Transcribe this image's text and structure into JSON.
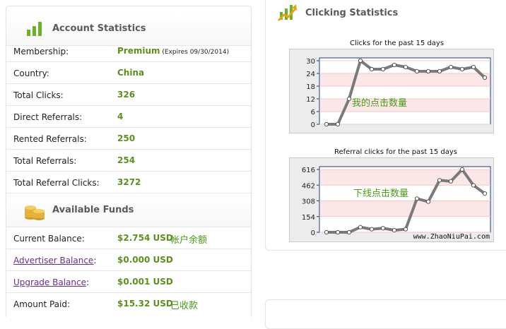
{
  "account": {
    "title": "Account Statistics",
    "rows": [
      {
        "label": "Membership:",
        "value": "Premium",
        "note": " (Expires 09/30/2014)"
      },
      {
        "label": "Country:",
        "value": "China"
      },
      {
        "label": "Total Clicks:",
        "value": "326"
      },
      {
        "label": "Direct Referrals:",
        "value": "4"
      },
      {
        "label": "Rented Referrals:",
        "value": "250"
      },
      {
        "label": "Total Referrals:",
        "value": "254"
      },
      {
        "label": "Total Referral Clicks:",
        "value": "3272"
      }
    ]
  },
  "funds": {
    "title": "Available Funds",
    "rows": [
      {
        "label": "Current Balance:",
        "value": "$2.754 USD",
        "annotation": "帐户余额"
      },
      {
        "label": "Advertiser Balance",
        "suffix": ":",
        "value": "$0.000 USD"
      },
      {
        "label": "Upgrade Balance",
        "suffix": ":",
        "value": "$0.001 USD"
      },
      {
        "label": "Amount Paid:",
        "value": "$15.32 USD",
        "annotation": "已收款"
      }
    ]
  },
  "clicking": {
    "title": "Clicking Statistics"
  },
  "chart_data": [
    {
      "type": "line",
      "title": "Clicks for the past 15 days",
      "annotation": "我的点击数量",
      "yticks": [
        0,
        6,
        12,
        18,
        24,
        30
      ],
      "ylim": [
        0,
        30
      ],
      "values": [
        0,
        0,
        12,
        30,
        26,
        26,
        28,
        27,
        25,
        25,
        25,
        27,
        26,
        27,
        22
      ],
      "grid": true
    },
    {
      "type": "line",
      "title": "Referral clicks for the past 15 days",
      "annotation": "下线点击数量",
      "watermark": "www.ZhaoNiuPai.com",
      "yticks": [
        0,
        154,
        308,
        462,
        616
      ],
      "ylim": [
        0,
        616
      ],
      "values": [
        0,
        0,
        0,
        50,
        30,
        40,
        20,
        30,
        330,
        300,
        510,
        500,
        616,
        460,
        380
      ],
      "grid": true
    }
  ],
  "colors": {
    "value_green": "#5c8f1f",
    "link_purple": "#6a2f87",
    "line_gray": "#7a7a7a",
    "band_pink": "#fbe7e7"
  },
  "icons": {
    "account": "bar-chart-icon",
    "funds": "coin-stack-icon",
    "clicking": "chart-arrow-icon"
  }
}
